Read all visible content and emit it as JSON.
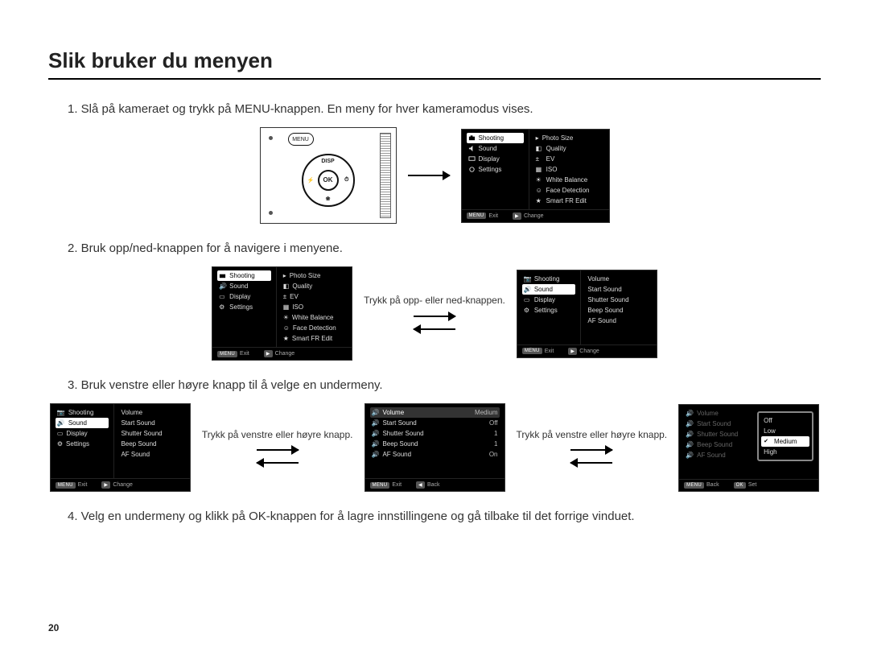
{
  "page_number": "20",
  "title": "Slik bruker du menyen",
  "steps": {
    "s1": "1. Slå på kameraet og trykk på MENU-knappen. En meny for hver kameramodus vises.",
    "s2": "2. Bruk opp/ned-knappen for å navigere i menyene.",
    "s3": "3. Bruk venstre eller høyre knapp til å velge en undermeny.",
    "s4": "4. Velg en undermeny og klikk på OK-knappen for å lagre innstillingene og gå tilbake til det forrige vinduet."
  },
  "captions": {
    "updown": "Trykk på opp- eller ned-knappen.",
    "leftright": "Trykk på venstre eller høyre knapp."
  },
  "camera_labels": {
    "menu": "MENU",
    "ok": "OK",
    "disp": "DISP"
  },
  "menu_left": {
    "shooting": "Shooting",
    "sound": "Sound",
    "display": "Display",
    "settings": "Settings"
  },
  "menu_shooting_right": {
    "photo_size": "Photo Size",
    "quality": "Quality",
    "ev": "EV",
    "iso": "ISO",
    "white_balance": "White Balance",
    "face_detection": "Face Detection",
    "smart_fr_edit": "Smart FR Edit"
  },
  "menu_sound_right": {
    "volume": "Volume",
    "start_sound": "Start Sound",
    "shutter_sound": "Shutter Sound",
    "beep_sound": "Beep Sound",
    "af_sound": "AF Sound"
  },
  "sound_values": {
    "volume": "Medium",
    "start_sound": "Off",
    "shutter_sound": "1",
    "beep_sound": "1",
    "af_sound": "On"
  },
  "volume_options": {
    "off": "Off",
    "low": "Low",
    "medium": "Medium",
    "high": "High"
  },
  "footer": {
    "exit": "Exit",
    "change": "Change",
    "back": "Back",
    "set": "Set",
    "menu_key": "MENU",
    "ok_key": "OK"
  }
}
